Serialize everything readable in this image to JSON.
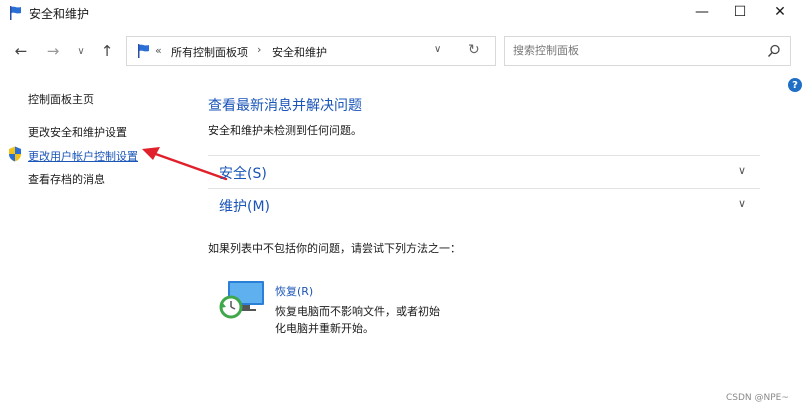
{
  "window": {
    "title": "安全和维护",
    "minimize_glyph": "—",
    "maximize_glyph": "☐",
    "close_glyph": "✕"
  },
  "nav": {
    "back_glyph": "←",
    "forward_glyph": "→",
    "recent_glyph": "∨",
    "up_glyph": "↑"
  },
  "address": {
    "chevron": "«",
    "crumbs": [
      "所有控制面板项",
      "安全和维护"
    ],
    "separator": "›",
    "dropdown_glyph": "∨",
    "refresh_glyph": "↻"
  },
  "search": {
    "placeholder": "搜索控制面板"
  },
  "help": {
    "glyph": "?"
  },
  "sidebar": {
    "items": [
      {
        "label": "控制面板主页"
      },
      {
        "label": "更改安全和维护设置"
      },
      {
        "label": "更改用户帐户控制设置"
      },
      {
        "label": "查看存档的消息"
      }
    ]
  },
  "main": {
    "heading": "查看最新消息并解决问题",
    "subtext": "安全和维护未检测到任何问题。",
    "sections": [
      {
        "label": "安全(S)",
        "chevron": "∨"
      },
      {
        "label": "维护(M)",
        "chevron": "∨"
      }
    ],
    "hint": "如果列表中不包括你的问题，请尝试下列方法之一：",
    "recovery": {
      "link": "恢复(R)",
      "desc_line1": "恢复电脑而不影响文件，或者初始",
      "desc_line2": "化电脑并重新开始。"
    }
  },
  "watermark": "CSDN @NPE~",
  "colors": {
    "link_blue": "#1a55b8",
    "annotation_red": "#e0202a",
    "help_blue": "#1f6fc5"
  },
  "icons": {
    "title": "flag-icon",
    "address": "flag-icon",
    "search": "search-icon",
    "uac": "shield-icon",
    "recovery": "recovery-icon"
  }
}
